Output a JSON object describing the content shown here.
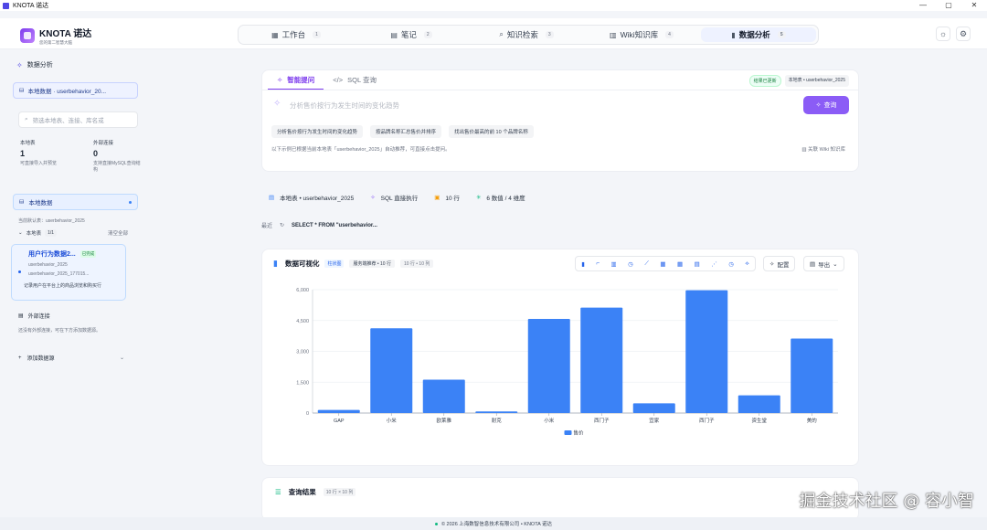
{
  "window": {
    "title": "KNOTA 诺达",
    "controls": [
      "—",
      "▢",
      "✕"
    ]
  },
  "brand": {
    "name": "KNOTA 诺达",
    "slogan": "您的第二智慧大脑"
  },
  "nav": {
    "tabs": [
      {
        "icon": "▦",
        "label": "工作台",
        "num": "1"
      },
      {
        "icon": "▤",
        "label": "笔记",
        "num": "2"
      },
      {
        "icon": "⌕",
        "label": "知识检索",
        "num": "3"
      },
      {
        "icon": "▥",
        "label": "Wiki知识库",
        "num": "4"
      },
      {
        "icon": "▮",
        "label": "数据分析",
        "num": "5",
        "active": true
      }
    ]
  },
  "sidebar": {
    "header": "数据分析",
    "datasource": "本地数据 · userbehavior_20...",
    "search_placeholder": "筛选本地表、连接、库名或",
    "stats": [
      {
        "label": "本地表",
        "value": "1",
        "desc": "可直接导入并预览"
      },
      {
        "label": "外部连接",
        "value": "0",
        "desc": "支持直接MySQL查询结构"
      }
    ],
    "local_section": "本地数据",
    "default_table": "当前默认表：userbehavior_2025",
    "tables_label": "本地表",
    "tables_count": "1/1",
    "clear_label": "清空全部",
    "card": {
      "title": "用户行为数据2...",
      "badge": "已完成",
      "sub1": "userbehavior_2025",
      "sub2": "userbehavior_2025_177015...",
      "desc": "记录用户在平台上的商品浏览和购买行"
    },
    "external_label": "外部连接",
    "external_desc": "还没有外部连接，可在下方添加数据源。",
    "add_label": "添加数据源"
  },
  "query": {
    "tabs": [
      {
        "icon": "✧",
        "label": "智能提问",
        "active": true
      },
      {
        "icon": "</>",
        "label": "SQL 查询"
      }
    ],
    "status": "结果已更新",
    "table_badge": "本地表 • userbehavior_2025",
    "placeholder": "分析售价按行为发生时间的变化趋势",
    "submit": "查询",
    "chips": [
      "分析售价按行为发生时间的变化趋势",
      "按品牌名称汇总售价并排序",
      "找出售价最高的前 10 个品牌名称"
    ],
    "hint": "以下示例已根据当前本地表「userbehavior_2025」自动推荐，可直接点击提问。",
    "wiki": "关联 Wiki 知识库"
  },
  "info": [
    {
      "icon": "▤",
      "label": "本地表 • userbehavior_2025"
    },
    {
      "icon": "✧",
      "label": "SQL 直接执行"
    },
    {
      "icon": "▣",
      "label": "10 行"
    },
    {
      "icon": "✳",
      "label": "6 数值 / 4 维度"
    }
  ],
  "sql_row": {
    "label": "最近",
    "sql": "SELECT * FROM \"userbehavior..."
  },
  "chart_card": {
    "title": "数据可视化",
    "tag": "柱状图",
    "meta": "服务端推荐 • 10 行",
    "meta2": "10 行 • 10 列",
    "config": "配置",
    "export": "导出",
    "tool_icons": [
      "▮",
      "⌐",
      "▥",
      "◷",
      "⟋",
      "▦",
      "▦",
      "▤",
      "⋰",
      "◷",
      "⟡"
    ]
  },
  "chart_data": {
    "type": "bar",
    "categories": [
      "GAP",
      "小米",
      "欧莱雅",
      "耐克",
      "小米",
      "西门子",
      "宜家",
      "西门子",
      "资生堂",
      "美的"
    ],
    "series": [
      {
        "name": "售价",
        "color": "#3b82f6",
        "values": [
          150,
          4120,
          1620,
          80,
          4580,
          5130,
          470,
          5970,
          860,
          3620
        ]
      }
    ],
    "yticks": [
      0,
      1500,
      3000,
      4500,
      6000
    ],
    "ytick_labels": [
      "0",
      "1,500",
      "3,000",
      "4,500",
      "6,000"
    ],
    "ylim": [
      0,
      6000
    ],
    "legend": "bottom"
  },
  "result": {
    "title": "查询结果",
    "count": "10 行 × 10 列"
  },
  "footer": "© 2026 上海数智信息技术有限公司 • KNOTA 诺达",
  "watermark": "掘金技术社区 @ 容小智"
}
